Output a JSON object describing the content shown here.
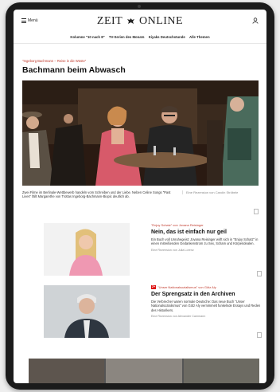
{
  "header": {
    "menu_label": "Menü",
    "logo_left": "ZEIT",
    "logo_right": "ONLINE",
    "nav": [
      "Kolumne \"10 nach 8\"",
      "TV-Serien des Monats",
      "Kiyaks Deutschstunde",
      "Alle Themen"
    ]
  },
  "lead": {
    "kicker": "\"Ingeborg Bachmann – Reise in die Wüste\"",
    "headline": "Bachmann beim Abwasch",
    "caption": "Zwei Filme im Berlinale-Wettbewerb handeln vom Schreiben und der Liebe. Neben Celine Songs \"Past Lives\" fällt Margarethe von Trottas Ingeborg-Bachmann-Biopic deutlich ab.",
    "author": "Eine Rezension von Carolin Ströbele"
  },
  "articles": [
    {
      "kicker": "\"Enjoy Schatz\" von Jovana Reisinger",
      "premium": false,
      "title": "Nein, das ist einfach nur geil",
      "teaser": "Ein Buch voll Unruhegeist: Jovana Reisinger wirft sich in \"Enjoy Schatz\" in einen mitreißenden Gedankenstrom zu Sex, Scham und Körperidealen.",
      "byline": "Eine Rezension von Julia Lorenz"
    },
    {
      "kicker": "\"Unser Nationalsozialismus\" von Götz Aly",
      "premium": true,
      "premium_label": "Z+",
      "title": "Der Sprengsatz in den Archiven",
      "teaser": "Die Verbrecher waren normale Deutsche: Das neue Buch \"Unser Nationalsozialismus\" von Götz Aly vernimmelt funkelnde Essays und Reden des Historikers.",
      "byline": "Eine Rezension von Alexander Cammann"
    }
  ],
  "colors": {
    "accent": "#c0392b",
    "premium": "#dd1111",
    "text": "#111111"
  }
}
